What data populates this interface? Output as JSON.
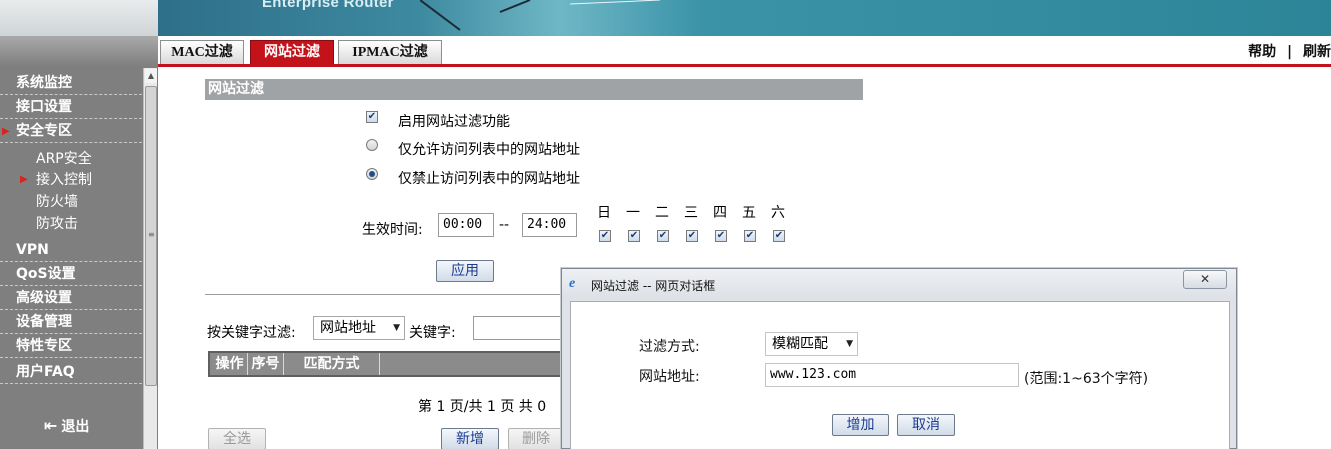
{
  "banner": {
    "subtitle": "Enterprise Router"
  },
  "sidebar": {
    "items": [
      {
        "label": "系统监控",
        "marker": false
      },
      {
        "label": "接口设置",
        "marker": false
      },
      {
        "label": "安全专区",
        "marker": true
      },
      {
        "label": "VPN",
        "marker": false
      },
      {
        "label": "QoS设置",
        "marker": false
      },
      {
        "label": "高级设置",
        "marker": false
      },
      {
        "label": "设备管理",
        "marker": false
      },
      {
        "label": "特性专区",
        "marker": false
      },
      {
        "label": "用户FAQ",
        "marker": false
      }
    ],
    "subitems": [
      {
        "label": "ARP安全",
        "marker": false
      },
      {
        "label": "接入控制",
        "marker": true
      },
      {
        "label": "防火墙",
        "marker": false
      },
      {
        "label": "防攻击",
        "marker": false
      }
    ],
    "logout_label": "退出",
    "marker_color": "#d8241c"
  },
  "tabs": [
    {
      "label": "MAC过滤",
      "active": false
    },
    {
      "label": "网站过滤",
      "active": true
    },
    {
      "label": "IPMAC过滤",
      "active": false
    }
  ],
  "toplinks": {
    "help": "帮助",
    "separator": "|",
    "refresh": "刷新"
  },
  "section": {
    "title": "网站过滤",
    "enable_label": "启用网站过滤功能",
    "enable_checked": true,
    "allow_label": "仅允许访问列表中的网站地址",
    "deny_label": "仅禁止访问列表中的网站地址",
    "mode_selected": "deny",
    "time_label": "生效时间:",
    "time_start": "00:00",
    "time_sep": "--",
    "time_end": "24:00",
    "days": [
      "日",
      "一",
      "二",
      "三",
      "四",
      "五",
      "六"
    ],
    "days_checked": [
      true,
      true,
      true,
      true,
      true,
      true,
      true
    ],
    "apply_label": "应用"
  },
  "filter": {
    "keyword_filter_label": "按关键字过滤:",
    "filter_select_value": "网站地址",
    "keyword_label": "关键字:",
    "keyword_value": ""
  },
  "table": {
    "headers": [
      "操作",
      "序号",
      "匹配方式"
    ],
    "pagination": "第 1 页/共 1 页 共 0"
  },
  "bottom_buttons": {
    "select_all": "全选",
    "add_new": "新增",
    "delete": "删除"
  },
  "dialog": {
    "title": "网站过滤 -- 网页对话框",
    "close_glyph": "✕",
    "filter_method_label": "过滤方式:",
    "filter_method_value": "模糊匹配",
    "website_label": "网站地址:",
    "website_value": "www.123.com",
    "range_hint": "(范围:1~63个字符)",
    "add_label": "增加",
    "cancel_label": "取消"
  },
  "colors": {
    "accent_red": "#c4121a",
    "sidebar_bg": "#7f7f7f",
    "section_header_bg": "#a0a3a5",
    "button_text": "#1b3d8f"
  }
}
